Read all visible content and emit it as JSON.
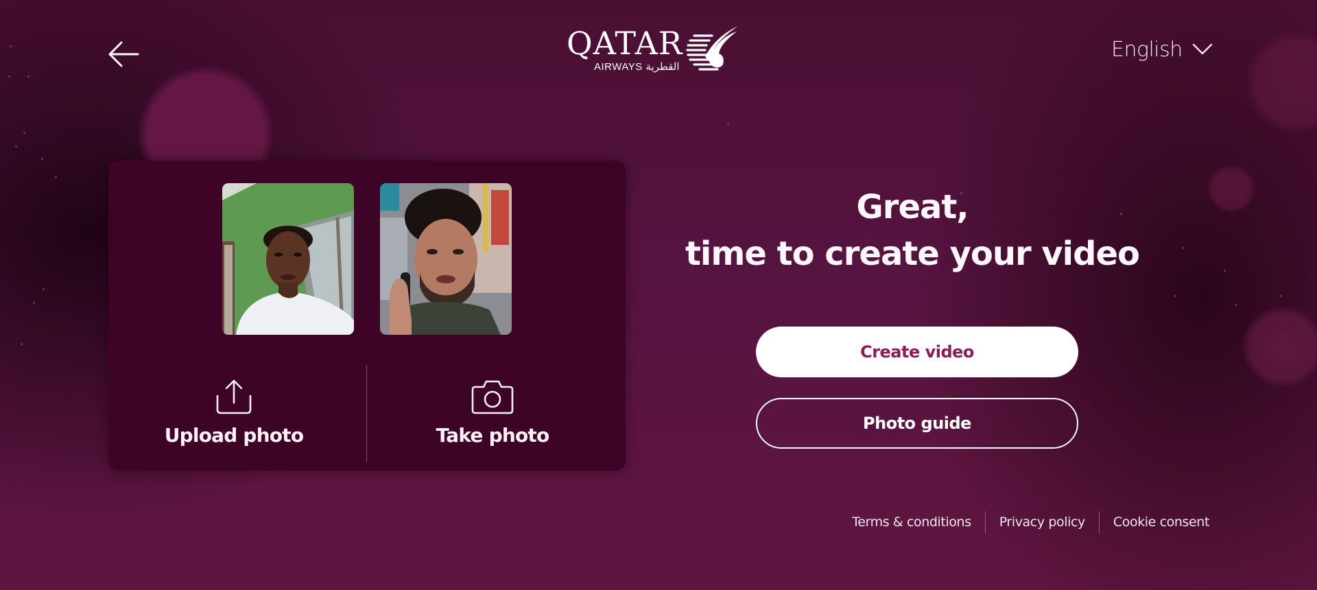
{
  "header": {
    "back_icon": "arrow-left-icon",
    "logo": {
      "wordmark": "QATAR",
      "sub_latin": "AIRWAYS",
      "sub_arabic": "القطرية",
      "emblem_icon": "oryx-emblem-icon"
    },
    "language": {
      "selected": "English",
      "icon": "chevron-down-icon"
    }
  },
  "card": {
    "photos": [
      {
        "alt": "Selfie of a man in a white t-shirt in front of a green wall"
      },
      {
        "alt": "Man with dark curly hair talking on a phone in a city street"
      }
    ],
    "actions": [
      {
        "label": "Upload photo",
        "icon": "upload-icon"
      },
      {
        "label": "Take photo",
        "icon": "camera-icon"
      }
    ]
  },
  "main": {
    "headline_line1": "Great,",
    "headline_line2": "time to create your video",
    "primary_button": "Create video",
    "secondary_button": "Photo guide"
  },
  "footer": {
    "links": [
      "Terms & conditions",
      "Privacy policy",
      "Cookie consent"
    ]
  },
  "colors": {
    "brand_burgundy": "#5c0f3e",
    "card_background": "#3e0428",
    "primary_button_text": "#8a1c5a",
    "text_white": "#ffffff"
  }
}
